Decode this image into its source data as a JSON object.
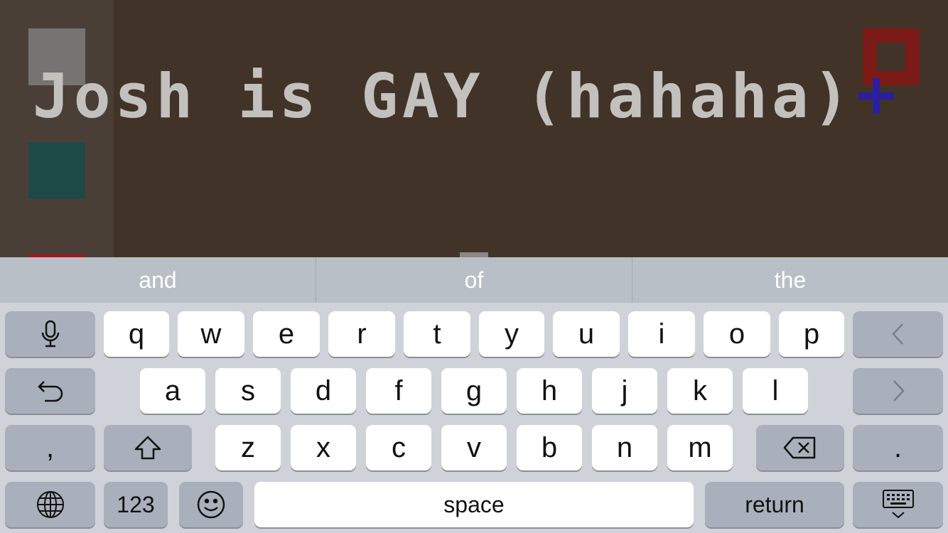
{
  "canvas": {
    "drawn_text": "Josh is GAY (hahaha)",
    "colors": {
      "background": "#413328",
      "palette_panel": "#4a3f37",
      "swatch_gray": "#767472",
      "swatch_teal": "#1d4a47",
      "swatch_red": "#a6161a",
      "text": "#c3c1bd",
      "red_outline": "#7b1a16",
      "blue_cursor": "#2a1f9e"
    }
  },
  "suggestions": [
    "and",
    "of",
    "the"
  ],
  "keyboard": {
    "row1": [
      "q",
      "w",
      "e",
      "r",
      "t",
      "y",
      "u",
      "i",
      "o",
      "p"
    ],
    "row2": [
      "a",
      "s",
      "d",
      "f",
      "g",
      "h",
      "j",
      "k",
      "l"
    ],
    "row3": [
      "z",
      "x",
      "c",
      "v",
      "b",
      "n",
      "m"
    ],
    "comma": ",",
    "period": ".",
    "numbers": "123",
    "space": "space",
    "return": "return",
    "icons": [
      "microphone-icon",
      "undo-icon",
      "arrow-left-icon",
      "arrow-right-icon",
      "shift-icon",
      "delete-icon",
      "globe-icon",
      "emoji-icon",
      "keyboard-dismiss-icon"
    ]
  }
}
